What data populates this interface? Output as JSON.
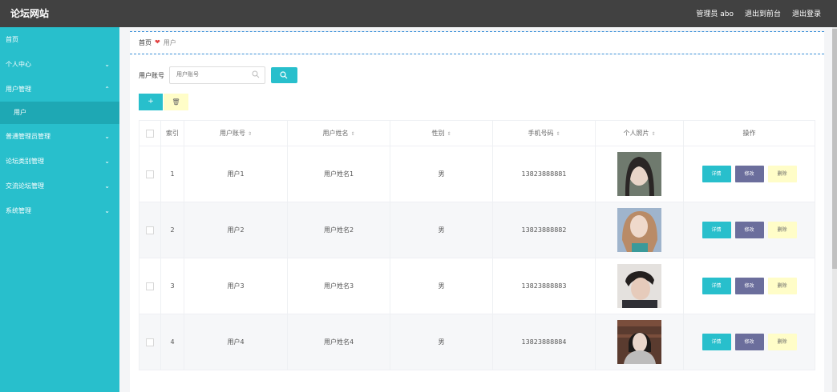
{
  "app": {
    "title": "论坛网站"
  },
  "header": {
    "user": "管理员 abo",
    "links": [
      "退出到前台",
      "退出登录"
    ]
  },
  "sidebar": {
    "items": [
      {
        "label": "首页",
        "chevron": ""
      },
      {
        "label": "个人中心",
        "chevron": "⌄"
      },
      {
        "label": "用户管理",
        "chevron": "⌃"
      },
      {
        "label": "用户",
        "chevron": ""
      },
      {
        "label": "普通管理员管理",
        "chevron": "⌄"
      },
      {
        "label": "论坛类别管理",
        "chevron": "⌄"
      },
      {
        "label": "交流论坛管理",
        "chevron": "⌄"
      },
      {
        "label": "系统管理",
        "chevron": "⌄"
      }
    ]
  },
  "breadcrumb": {
    "home": "首页",
    "sep": "❤",
    "current": "用户"
  },
  "search": {
    "label": "用户账号",
    "placeholder": "用户账号"
  },
  "actions": {
    "add": "+",
    "delete": "🗑"
  },
  "table": {
    "headers": [
      "索引",
      "用户账号",
      "用户姓名",
      "性别",
      "手机号码",
      "个人照片",
      "操作"
    ],
    "sort_glyph": "⇕",
    "rows": [
      {
        "index": "1",
        "account": "用户1",
        "name": "用户姓名1",
        "gender": "男",
        "phone": "13823888881"
      },
      {
        "index": "2",
        "account": "用户2",
        "name": "用户姓名2",
        "gender": "男",
        "phone": "13823888882"
      },
      {
        "index": "3",
        "account": "用户3",
        "name": "用户姓名3",
        "gender": "男",
        "phone": "13823888883"
      },
      {
        "index": "4",
        "account": "用户4",
        "name": "用户姓名4",
        "gender": "男",
        "phone": "13823888884"
      }
    ],
    "row_buttons": {
      "detail": "详情",
      "edit": "修改",
      "delete": "删除"
    }
  },
  "colors": {
    "accent": "#28bfcc",
    "topbar": "#414141",
    "edit": "#6b6e9c",
    "delete": "#fffdc8"
  }
}
